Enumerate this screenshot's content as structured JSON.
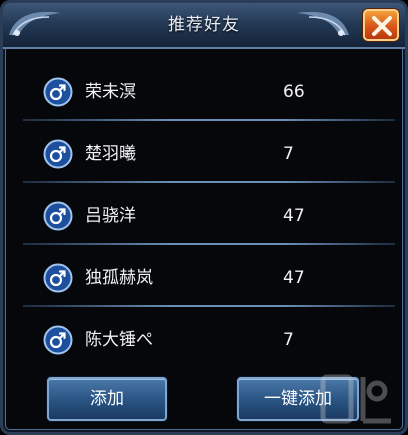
{
  "dialog": {
    "title": "推荐好友"
  },
  "friends": [
    {
      "name": "荣未溟",
      "level": "66",
      "gender": "male"
    },
    {
      "name": "楚羽曦",
      "level": "7",
      "gender": "male"
    },
    {
      "name": "吕骁洋",
      "level": "47",
      "gender": "male"
    },
    {
      "name": "独孤赫岚",
      "level": "47",
      "gender": "male"
    },
    {
      "name": "陈大锤ぺ",
      "level": "7",
      "gender": "male"
    }
  ],
  "buttons": {
    "add": "添加",
    "add_all": "一键添加"
  },
  "colors": {
    "title_bar": "#243a56",
    "close_button": "#d8561a",
    "button": "#2b5685",
    "background": "#05070b"
  }
}
